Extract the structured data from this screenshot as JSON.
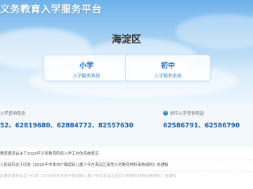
{
  "header": {
    "site_title": "义务教育入学服务平台"
  },
  "district": "海淀区",
  "cards": [
    {
      "title": "小学",
      "subtitle": "入学服务系统"
    },
    {
      "title": "初中",
      "subtitle": "入学服务系统"
    }
  ],
  "contacts": {
    "primary": {
      "label": "入学咨询电话",
      "phones": "52、62819680、62884772、82557630"
    },
    "junior": {
      "label": "初中入学咨询电话",
      "phones": "62586791、62586790"
    }
  },
  "news": [
    "教育委员会关于2025年义务教育阶段入学工作的实施意见",
    "人民政府关于印发《2025年非本市户籍适龄儿童少年在海淀区接受义务教育材料审核细则》的通知",
    "区教育委员会关于印发《2025年非本市户籍适龄儿童少年在海淀区接受义务教育材料审核细则》的通知"
  ],
  "colors": {
    "accent": "#1f6fbf",
    "phones": "#1b5fa8"
  }
}
